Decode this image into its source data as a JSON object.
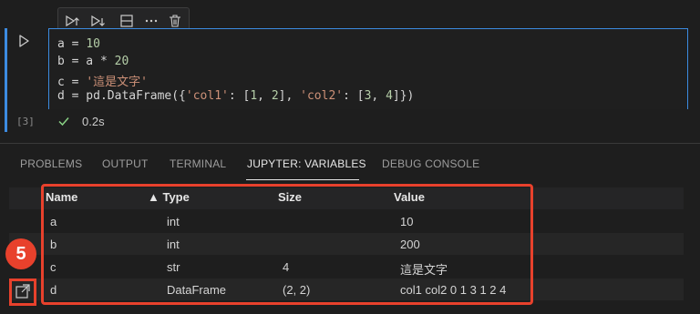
{
  "cell": {
    "execution_count": "[3]",
    "status_time": "0.2s",
    "code_lines": [
      {
        "parts": [
          {
            "t": "a = ",
            "c": ""
          },
          {
            "t": "10",
            "c": "num"
          }
        ]
      },
      {
        "parts": [
          {
            "t": "b = a * ",
            "c": ""
          },
          {
            "t": "20",
            "c": "num"
          }
        ]
      },
      {
        "parts": [
          {
            "t": "c = ",
            "c": ""
          },
          {
            "t": "'這是文字'",
            "c": "str"
          }
        ]
      },
      {
        "parts": [
          {
            "t": "d = pd.DataFrame({",
            "c": ""
          },
          {
            "t": "'col1'",
            "c": "str"
          },
          {
            "t": ": [",
            "c": ""
          },
          {
            "t": "1",
            "c": "num"
          },
          {
            "t": ", ",
            "c": ""
          },
          {
            "t": "2",
            "c": "num"
          },
          {
            "t": "], ",
            "c": ""
          },
          {
            "t": "'col2'",
            "c": "str"
          },
          {
            "t": ": [",
            "c": ""
          },
          {
            "t": "3",
            "c": "num"
          },
          {
            "t": ", ",
            "c": ""
          },
          {
            "t": "4",
            "c": "num"
          },
          {
            "t": "]})",
            "c": ""
          }
        ]
      }
    ],
    "toolbar_icons": [
      "run-above-icon",
      "run-below-icon",
      "split-cell-icon",
      "more-icon",
      "delete-icon"
    ]
  },
  "panel": {
    "tabs": [
      "PROBLEMS",
      "OUTPUT",
      "TERMINAL",
      "JUPYTER: VARIABLES",
      "DEBUG CONSOLE"
    ],
    "active_tab": "JUPYTER: VARIABLES"
  },
  "variables": {
    "headers": {
      "name": "Name",
      "type": "▲ Type",
      "size": "Size",
      "value": "Value"
    },
    "rows": [
      {
        "name": "a",
        "type": "int",
        "size": "",
        "value": "10"
      },
      {
        "name": "b",
        "type": "int",
        "size": "",
        "value": "200"
      },
      {
        "name": "c",
        "type": "str",
        "size": "4",
        "value": "這是文字"
      },
      {
        "name": "d",
        "type": "DataFrame",
        "size": "(2, 2)",
        "value": "col1 col2 0 1 3 1 2 4"
      }
    ]
  },
  "annotation": {
    "badge": "5",
    "color": "#e8412c"
  },
  "colors": {
    "accent": "#3c8be0",
    "success": "#89d185"
  }
}
